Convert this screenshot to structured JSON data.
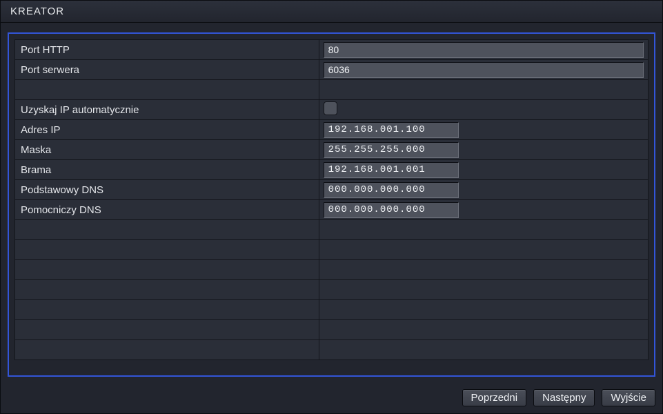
{
  "title": "KREATOR",
  "rows": {
    "http_port": {
      "label": "Port HTTP",
      "value": "80"
    },
    "server_port": {
      "label": "Port serwera",
      "value": "6036"
    },
    "dhcp": {
      "label": "Uzyskaj IP automatycznie",
      "checked": false
    },
    "ip": {
      "label": "Adres IP",
      "value": "192.168.001.100"
    },
    "mask": {
      "label": "Maska",
      "value": "255.255.255.000"
    },
    "gateway": {
      "label": "Brama",
      "value": "192.168.001.001"
    },
    "dns1": {
      "label": "Podstawowy DNS",
      "value": "000.000.000.000"
    },
    "dns2": {
      "label": "Pomocniczy DNS",
      "value": "000.000.000.000"
    }
  },
  "buttons": {
    "prev": "Poprzedni",
    "next": "Następny",
    "exit": "Wyjście"
  }
}
